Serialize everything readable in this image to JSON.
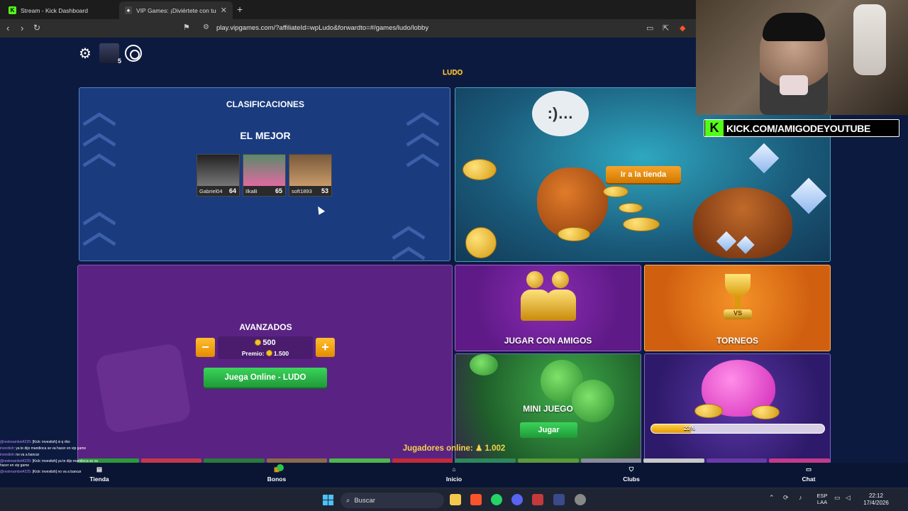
{
  "browser": {
    "tabs": [
      {
        "title": "Stream - Kick Dashboard",
        "favicon": "kick-icon",
        "active": false
      },
      {
        "title": "VIP Games: ¡Diviértete con tus a",
        "favicon": "vip-icon",
        "active": true
      }
    ],
    "new_tab": "+",
    "url": "play.vipgames.com/?affiliateId=wpLudo&forwardto=#/games/ludo/lobby"
  },
  "app": {
    "logo": "LUDO",
    "player_level": "5",
    "rankings": {
      "title": "CLASIFICACIONES",
      "subtitle": "EL MEJOR",
      "players": [
        {
          "name": "Gabriel04",
          "score": "64"
        },
        {
          "name": "IlkaB",
          "score": "65"
        },
        {
          "name": "soft1893",
          "score": "53"
        }
      ]
    },
    "store": {
      "button": "Ir a la tienda"
    },
    "advanced": {
      "title": "AVANZADOS",
      "minus": "−",
      "plus": "+",
      "bet": "500",
      "prize": "Premio:",
      "prize_value": "1.500",
      "play": "Juega Online - LUDO"
    },
    "tiles": {
      "friends": "JUGAR CON AMIGOS",
      "tournaments": "TORNEOS",
      "tournament_vs": "VS",
      "mini_game": "MINI JUEGO",
      "mini_game_button": "Jugar",
      "piggy_progress_label": "23%",
      "piggy_progress": 0.23
    },
    "online": {
      "label": "Jugadores online:",
      "count": "1.002"
    },
    "bottom_nav": [
      {
        "label": "Tienda",
        "icon": "store-icon"
      },
      {
        "label": "Bonos",
        "icon": "gift-icon"
      },
      {
        "label": "Inicio",
        "icon": "home-icon"
      },
      {
        "label": "Clubs",
        "icon": "shield-icon"
      },
      {
        "label": "Chat",
        "icon": "chat-icon"
      }
    ]
  },
  "overlay": {
    "kick_banner": "KICK.COM/AMIGODEYOUTUBE",
    "kick_logo": "K",
    "chat": [
      {
        "user": "@restreambot4225",
        "text": ": [Kick: investish] si q riko"
      },
      {
        "user": "investish",
        "text": ": ya te dijo mandioca se va hacer en vip game"
      },
      {
        "user": "investish",
        "text": ": no va a bancar"
      },
      {
        "user": "@restreambot4225",
        "text": ": [Kick: investish] ya te dijo mandioca se va hacer en vip game"
      },
      {
        "user": "@restreambot4225",
        "text": ": [Kick: investish] no va a bancar"
      }
    ]
  },
  "taskbar": {
    "search": "Buscar",
    "lang_top": "ESP",
    "lang_bottom": "LAA",
    "time": "22:12",
    "date": "17/4/2026"
  },
  "colors": {
    "accent_green": "#2ec44a",
    "accent_orange": "#f29a1c",
    "panel_blue": "#1a3b7e",
    "panel_purple": "#5a2383",
    "kick_green": "#53fc18"
  }
}
